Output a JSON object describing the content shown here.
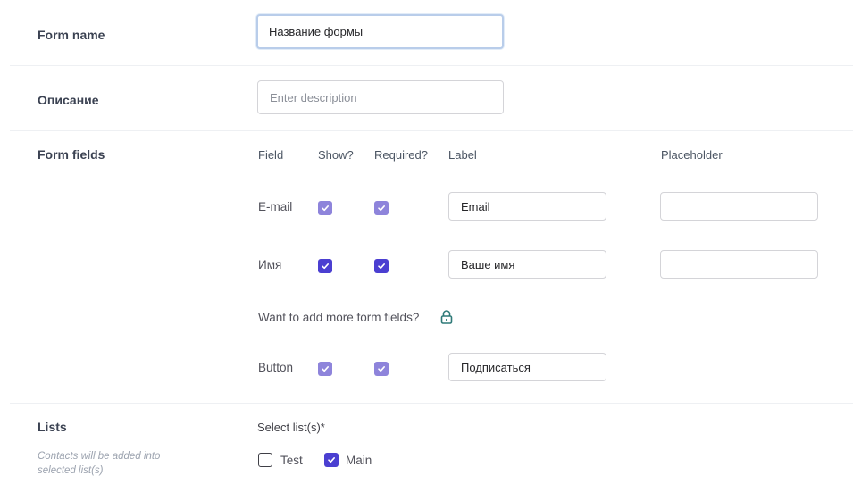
{
  "form_name": {
    "label": "Form name",
    "value": "Название формы"
  },
  "description": {
    "label": "Описание",
    "placeholder": "Enter description"
  },
  "form_fields": {
    "label": "Form fields",
    "columns": {
      "field": "Field",
      "show": "Show?",
      "required": "Required?",
      "label": "Label",
      "placeholder": "Placeholder"
    },
    "rows": [
      {
        "field": "E-mail",
        "show": true,
        "required": true,
        "label_value": "Email",
        "placeholder_value": ""
      },
      {
        "field": "Имя",
        "show": true,
        "required": true,
        "label_value": "Ваше имя",
        "placeholder_value": ""
      },
      {
        "field": "Button",
        "show": true,
        "required": true,
        "label_value": "Подписаться"
      }
    ],
    "more_fields_text": "Want to add more form fields?",
    "lock_icon_color": "#2f7a78"
  },
  "lists": {
    "label": "Lists",
    "hint": "Contacts will be added into selected list(s)",
    "select_label": "Select list(s)*",
    "options": [
      {
        "name": "Test",
        "checked": false
      },
      {
        "name": "Main",
        "checked": true
      }
    ]
  },
  "colors": {
    "checkbox_disabled": "#8e84db",
    "checkbox_active": "#4b3fd1",
    "focus_border": "#b9cdea"
  }
}
